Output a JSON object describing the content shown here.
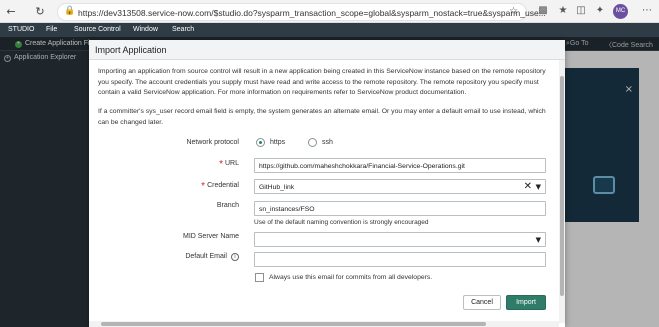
{
  "browser": {
    "url": "https://dev313508.service-now.com/$studio.do?sysparm_transaction_scope=global&sysparm_nostack=true&sysparm_use...",
    "avatar_initials": "MC"
  },
  "studio": {
    "menu": [
      "STUDIO",
      "File",
      "Source Control",
      "Window",
      "Search"
    ],
    "create_label": "Create Application Fi",
    "goto_label": "Go To",
    "code_search_label": "Code Search",
    "sidebar_item": "Application Explorer"
  },
  "dialog": {
    "title": "Import Application",
    "intro": "Importing an application from source control will result in a new application being created in this ServiceNow instance based on the remote repository you specify. The account credentials you supply must have read and write access to the remote repository. The remote repository you specify must contain a valid ServiceNow application. For more information on requirements refer to ServiceNow product documentation.",
    "email_note": "If a committer's sys_user record email field is empty, the system generates an alternate email. Or you may enter a default email to use instead, which can be changed later.",
    "network_protocol": {
      "label": "Network protocol",
      "options": [
        "https",
        "ssh"
      ],
      "selected": "https"
    },
    "url": {
      "label": "URL",
      "value": "https://github.com/maheshchokkara/Financial-Service-Operations.git"
    },
    "credential": {
      "label": "Credential",
      "value": "GitHub_link"
    },
    "branch": {
      "label": "Branch",
      "value": "sn_instances/FSO",
      "hint": "Use of the default naming convention is strongly encouraged"
    },
    "mid_server": {
      "label": "MID Server Name",
      "value": ""
    },
    "default_email": {
      "label": "Default Email",
      "value": ""
    },
    "always_use_label": "Always use this email for commits from all developers.",
    "always_use_checked": false,
    "cancel_label": "Cancel",
    "import_label": "Import"
  },
  "colors": {
    "primary_button": "#2f7c69",
    "required_marker": "#d9232e",
    "studio_header": "#2f3b45"
  }
}
